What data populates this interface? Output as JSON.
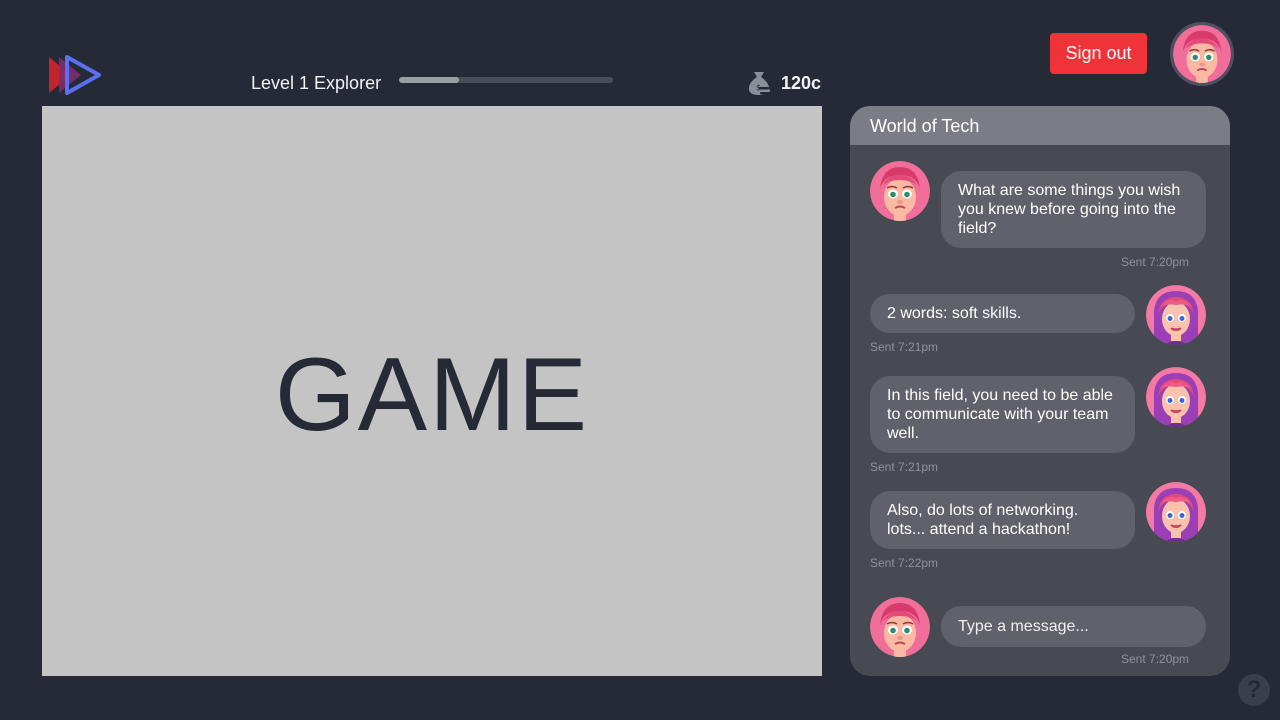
{
  "header": {
    "level_label": "Level 1 Explorer",
    "xp_progress": 0.28,
    "coins": "120c",
    "sign_out_label": "Sign out"
  },
  "game": {
    "label": "GAME"
  },
  "chat": {
    "title": "World of Tech",
    "messages": [
      {
        "sender": "self",
        "text": "What are some things you wish you knew before going into the field?",
        "time": "Sent 7:20pm"
      },
      {
        "sender": "other",
        "text": "2 words: soft skills.",
        "time": "Sent 7:21pm"
      },
      {
        "sender": "other",
        "text": "In this field, you need to be able to communicate with your team well.",
        "time": "Sent 7:21pm"
      },
      {
        "sender": "other",
        "text": "Also, do lots of networking. lots... attend a hackathon!",
        "time": "Sent 7:22pm"
      }
    ],
    "input_placeholder": "Type a message...",
    "input_time": "Sent 7:20pm"
  },
  "help": {
    "label": "?"
  },
  "colors": {
    "background": "#252a36",
    "accent_red": "#ef3338",
    "panel": "#474a53",
    "bubble": "#5f626a"
  },
  "icons": {
    "logo": "play-arrows-logo",
    "coins": "money-bag-icon",
    "help": "question-icon"
  }
}
